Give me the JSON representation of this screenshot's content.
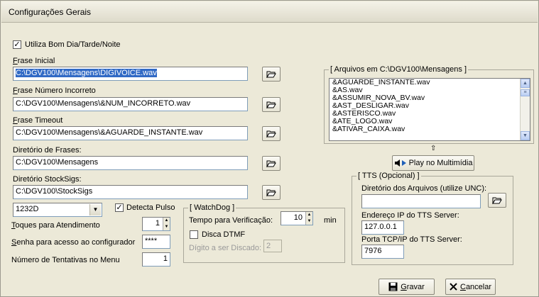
{
  "window": {
    "title": "Configurações Gerais"
  },
  "general": {
    "greeting_checkbox_label": "Utiliza Bom Dia/Tarde/Noite",
    "greeting_checked": true
  },
  "frase_inicial": {
    "label": "Frase Inicial",
    "value": "C:\\DGV100\\Mensagens\\DIGIVOICE.wav"
  },
  "frase_numero_incorreto": {
    "label": "Frase Número Incorreto",
    "value": "C:\\DGV100\\Mensagens\\&NUM_INCORRETO.wav"
  },
  "frase_timeout": {
    "label": "Frase Timeout",
    "value": "C:\\DGV100\\Mensagens\\&AGUARDE_INSTANTE.wav"
  },
  "diretorio_frases": {
    "label": "Diretório de Frases:",
    "value": "C:\\DGV100\\Mensagens"
  },
  "diretorio_stocksigs": {
    "label": "Diretório StockSigs:",
    "value": "C:\\DGV100\\StockSigs"
  },
  "device_combo": {
    "value": "1232D"
  },
  "detecta_pulso": {
    "label": "Detecta Pulso",
    "checked": true
  },
  "toques": {
    "label": "Toques para Atendimento",
    "value": "1"
  },
  "senha": {
    "label": "Senha para acesso ao configurador",
    "value": "****"
  },
  "tentativas": {
    "label": "Número de Tentativas no Menu",
    "value": "1"
  },
  "watchdog": {
    "title": "WatchDog",
    "tempo_label": "Tempo para Verificação:",
    "tempo_value": "10",
    "tempo_unit": "min",
    "disca_dtmf_label": "Disca DTMF",
    "disca_dtmf_checked": false,
    "digito_label": "Dígito a ser Discado:",
    "digito_value": "2"
  },
  "arquivos": {
    "title": "Arquivos em C:\\DGV100\\Mensagens",
    "items": [
      "&AGUARDE_INSTANTE.wav",
      "&AS.wav",
      "&ASSUMIR_NOVA_BV.wav",
      "&AST_DESLIGAR.wav",
      "&ASTERISCO.wav",
      "&ATE_LOGO.wav",
      "&ATIVAR_CAIXA.wav"
    ]
  },
  "play_button": {
    "label": "Play no Multimídia"
  },
  "tts": {
    "title": "TTS (Opcional)",
    "dir_label": "Diretório dos Arquivos (utilize UNC):",
    "dir_value": "",
    "ip_label": "Endereço IP do TTS Server:",
    "ip_value": "127.0.0.1",
    "port_label": "Porta TCP/IP do TTS Server:",
    "port_value": "7976"
  },
  "actions": {
    "save_label": "Gravar",
    "cancel_label": "Cancelar"
  },
  "icons": {
    "folder": "folder-open-icon",
    "save": "floppy-disk-icon",
    "cancel": "x-icon",
    "play": "speaker-play-icon"
  }
}
